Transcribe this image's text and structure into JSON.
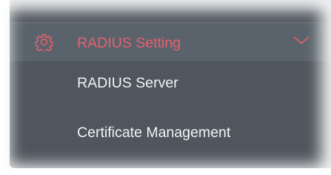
{
  "menu": {
    "top_partial_text": "",
    "section": {
      "label": "RADIUS Setting",
      "icon": "gear-icon",
      "expanded": true
    },
    "items": [
      {
        "label": "RADIUS Server"
      },
      {
        "label": "Certificate Management"
      }
    ]
  },
  "colors": {
    "panel_bg": "#4f565d",
    "header_bg": "#5a636b",
    "accent": "#e7606c",
    "item_text": "#f2f3f4"
  }
}
